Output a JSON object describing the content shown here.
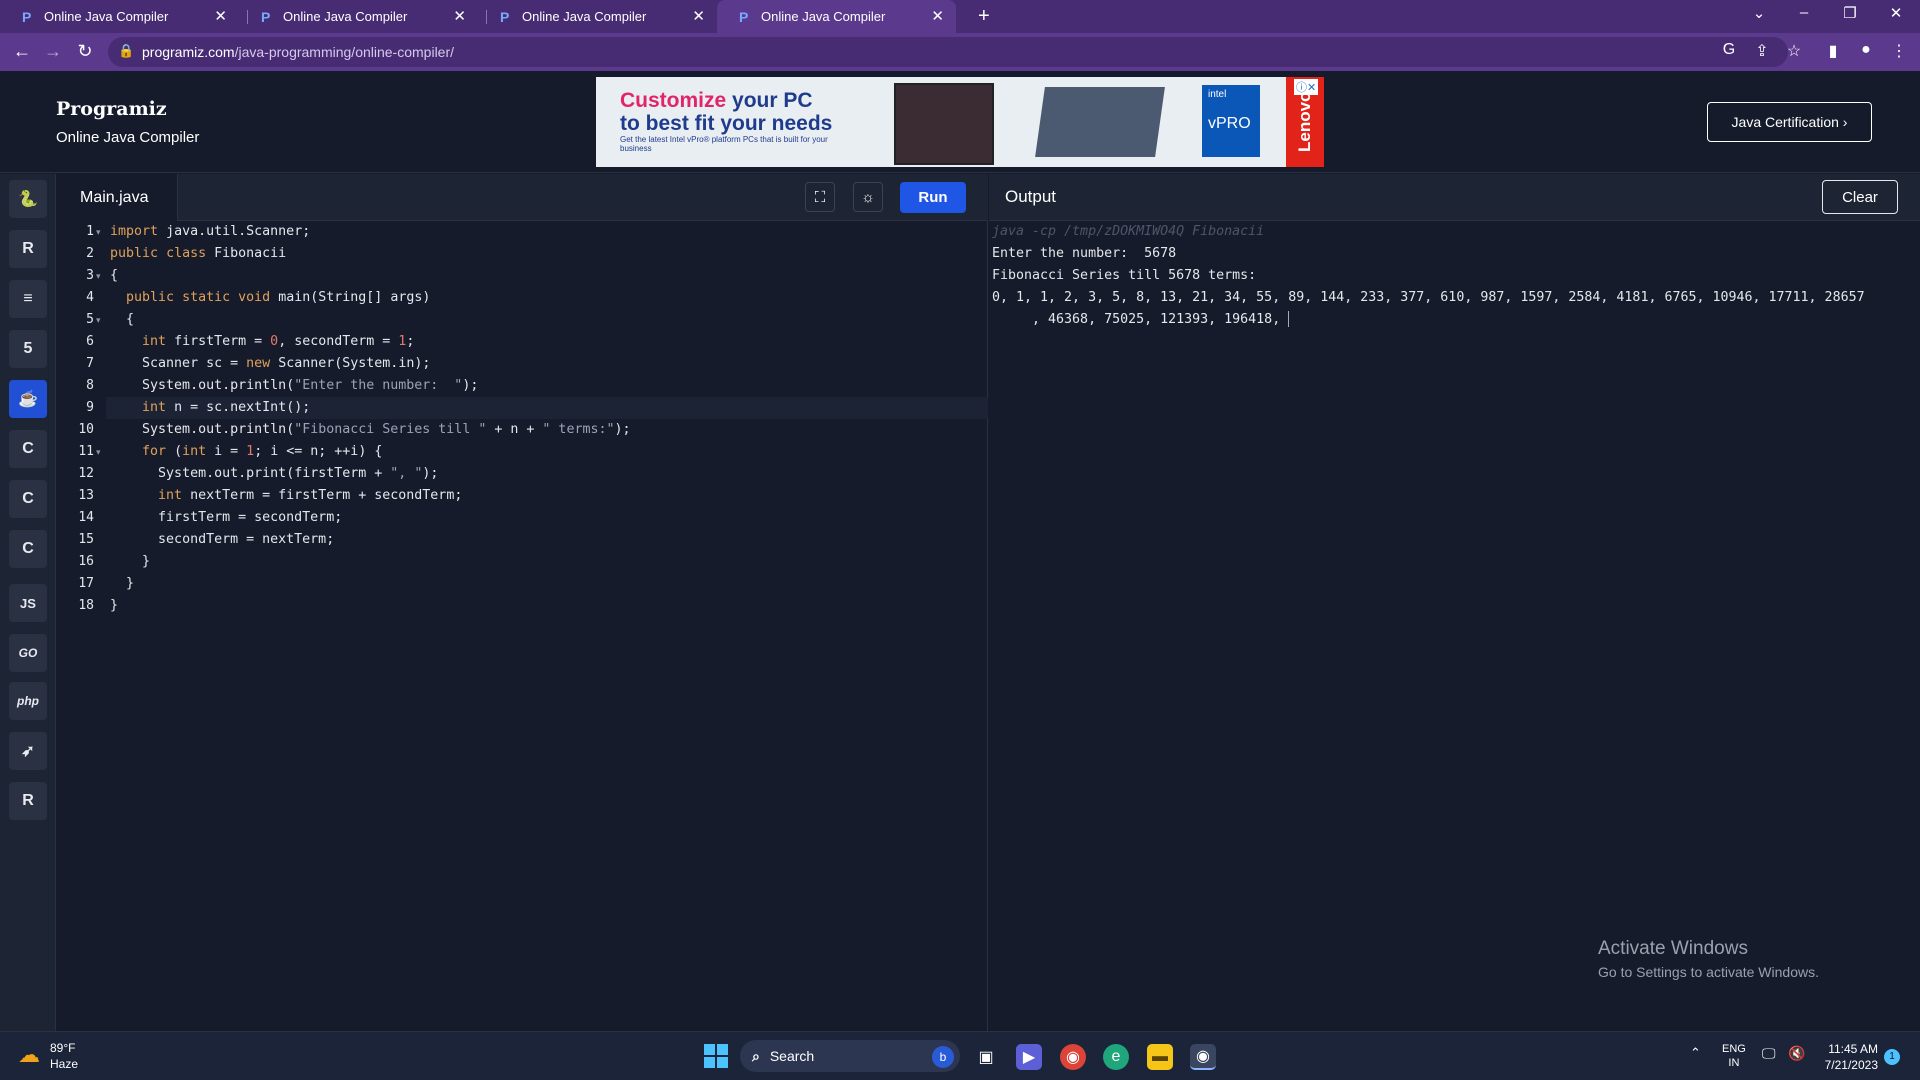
{
  "browser": {
    "tabs": [
      {
        "title": "Online Java Compiler"
      },
      {
        "title": "Online Java Compiler"
      },
      {
        "title": "Online Java Compiler"
      },
      {
        "title": "Online Java Compiler"
      }
    ],
    "url_host": "programiz.com",
    "url_path": "/java-programming/online-compiler/"
  },
  "site": {
    "logo": "Programiz",
    "subtitle": "Online Java Compiler",
    "certification_button": "Java Certification ›"
  },
  "ad": {
    "headline_pink": "Customize",
    "headline_blue": " your PC",
    "headline_line2": "to best fit your needs",
    "small_text": "Get the latest Intel vPro® platform PCs that is built for your business",
    "chip_brand": "intel",
    "chip_label": "vPRO",
    "advertiser": "Lenovo"
  },
  "sidebar": {
    "languages": [
      {
        "name": "python",
        "glyph": "🐍"
      },
      {
        "name": "r",
        "glyph": "R"
      },
      {
        "name": "sql",
        "glyph": "≡"
      },
      {
        "name": "html",
        "glyph": "5"
      },
      {
        "name": "java",
        "glyph": "☕"
      },
      {
        "name": "c",
        "glyph": "C"
      },
      {
        "name": "cpp",
        "glyph": "C"
      },
      {
        "name": "csharp",
        "glyph": "C"
      },
      {
        "name": "javascript",
        "glyph": "JS"
      },
      {
        "name": "go",
        "glyph": "GO"
      },
      {
        "name": "php",
        "glyph": "php"
      },
      {
        "name": "swift",
        "glyph": "➶"
      },
      {
        "name": "rust",
        "glyph": "R"
      }
    ],
    "active": "java"
  },
  "editor": {
    "filename": "Main.java",
    "run_label": "Run",
    "line_numbers": [
      "1",
      "2",
      "3",
      "4",
      "5",
      "6",
      "7",
      "8",
      "9",
      "10",
      "11",
      "12",
      "13",
      "14",
      "15",
      "16",
      "17",
      "18"
    ]
  },
  "output": {
    "title": "Output",
    "clear_label": "Clear",
    "command": "java -cp /tmp/zDOKMIWO4Q Fibonacii",
    "lines": [
      "Enter the number:  5678",
      "Fibonacci Series till 5678 terms:",
      "0, 1, 1, 2, 3, 5, 8, 13, 21, 34, 55, 89, 144, 233, 377, 610, 987, 1597, 2584, 4181, 6765, 10946, 17711, 28657",
      "     , 46368, 75025, 121393, 196418, "
    ]
  },
  "watermark": {
    "line1": "Activate Windows",
    "line2": "Go to Settings to activate Windows."
  },
  "taskbar": {
    "temperature": "89°F",
    "weather": "Haze",
    "search_placeholder": "Search",
    "language": "ENG",
    "region": "IN",
    "time": "11:45 AM",
    "date": "7/21/2023",
    "notifications": "1"
  }
}
